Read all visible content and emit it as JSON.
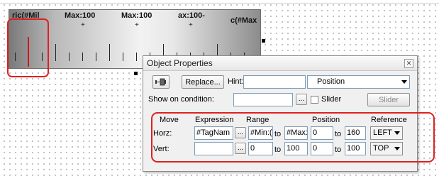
{
  "ruler": {
    "labels": [
      "ric(#Mil",
      "Max:100",
      "Max:100",
      "ax:100-",
      "c(#Max"
    ],
    "plus": [
      "+",
      "+",
      "+"
    ]
  },
  "dialog": {
    "title": "Object Properties",
    "replace_label": "Replace...",
    "hint_label": "Hint:",
    "hint_value": "",
    "position_combo": "Position",
    "show_condition_label": "Show on condition:",
    "show_condition_value": "",
    "browse_label": "...",
    "slider_checkbox_label": "Slider",
    "slider_button_label": "Slider",
    "headers": {
      "move": "Move",
      "expression": "Expression",
      "range": "Range",
      "position": "Position",
      "reference": "Reference"
    },
    "to_label": "to",
    "horz": {
      "label": "Horz:",
      "expression": "#TagNam",
      "range_from": "#Min:(",
      "range_to": "#Max:",
      "pos_from": "0",
      "pos_to": "160",
      "reference": "LEFT"
    },
    "vert": {
      "label": "Vert:",
      "expression": "",
      "range_from": "0",
      "range_to": "100",
      "pos_from": "0",
      "pos_to": "100",
      "reference": "TOP"
    }
  },
  "colors": {
    "highlight": "#e02020",
    "needle": "#d01818"
  },
  "icons": [
    "pin-icon",
    "close-icon",
    "dropdown-arrow-icon"
  ]
}
